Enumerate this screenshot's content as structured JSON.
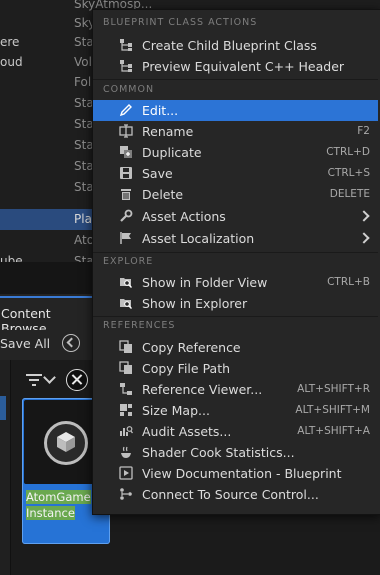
{
  "outliner": {
    "rows": [
      {
        "c1": "",
        "c2": "SkyAtmosp..."
      },
      {
        "c1": "",
        "c2": "Sky"
      },
      {
        "c1": "ere",
        "c2": "Sta"
      },
      {
        "c1": "oud",
        "c2": "Vol"
      },
      {
        "c1": "",
        "c2": "Fol"
      },
      {
        "c1": "",
        "c2": "Sta"
      },
      {
        "c1": "",
        "c2": "Sta"
      },
      {
        "c1": "",
        "c2": "Sta"
      },
      {
        "c1": "",
        "c2": "Sta"
      },
      {
        "c1": "",
        "c2": "Sta"
      },
      {
        "c1": "",
        "c2": "Pla"
      },
      {
        "c1": "",
        "c2": "Ato"
      },
      {
        "c1": "ube",
        "c2": "Sta"
      }
    ]
  },
  "content_browser": {
    "tab_label": "Content Browse",
    "save_all": "Save All",
    "asset_tile": {
      "name": "AtomGame Instance"
    }
  },
  "menu": {
    "sections": {
      "blueprint": "BLUEPRINT CLASS ACTIONS",
      "common": "COMMON",
      "explore": "EXPLORE",
      "references": "REFERENCES"
    },
    "blueprint_items": [
      {
        "label": "Create Child Blueprint Class",
        "shortcut": "",
        "icon": "hierarchy-icon"
      },
      {
        "label": "Preview Equivalent C++ Header",
        "shortcut": "",
        "icon": "hierarchy-icon"
      }
    ],
    "common_items": [
      {
        "label": "Edit...",
        "shortcut": "",
        "icon": "pencil-icon"
      },
      {
        "label": "Rename",
        "shortcut": "F2",
        "icon": "rename-icon"
      },
      {
        "label": "Duplicate",
        "shortcut": "CTRL+D",
        "icon": "duplicate-icon"
      },
      {
        "label": "Save",
        "shortcut": "CTRL+S",
        "icon": "save-icon"
      },
      {
        "label": "Delete",
        "shortcut": "DELETE",
        "icon": "trash-icon"
      },
      {
        "label": "Asset Actions",
        "shortcut": "",
        "icon": "wrench-icon"
      },
      {
        "label": "Asset Localization",
        "shortcut": "",
        "icon": "flag-icon"
      }
    ],
    "explore_items": [
      {
        "label": "Show in Folder View",
        "shortcut": "CTRL+B",
        "icon": "folder-search-icon"
      },
      {
        "label": "Show in Explorer",
        "shortcut": "",
        "icon": "folder-search-icon"
      }
    ],
    "reference_items": [
      {
        "label": "Copy Reference",
        "shortcut": "",
        "icon": "copy-icon"
      },
      {
        "label": "Copy File Path",
        "shortcut": "",
        "icon": "copy-icon"
      },
      {
        "label": "Reference Viewer...",
        "shortcut": "ALT+SHIFT+R",
        "icon": "reference-viewer-icon"
      },
      {
        "label": "Size Map...",
        "shortcut": "ALT+SHIFT+M",
        "icon": "size-map-icon"
      },
      {
        "label": "Audit Assets...",
        "shortcut": "ALT+SHIFT+A",
        "icon": "audit-icon"
      },
      {
        "label": "Shader Cook Statistics...",
        "shortcut": "",
        "icon": "shader-icon"
      },
      {
        "label": "View Documentation - Blueprint",
        "shortcut": "",
        "icon": "documentation-icon"
      },
      {
        "label": "Connect To Source Control...",
        "shortcut": "",
        "icon": "source-control-icon"
      }
    ],
    "highlighted_item": "Edit...",
    "highlight_color": "#2c74d6"
  }
}
